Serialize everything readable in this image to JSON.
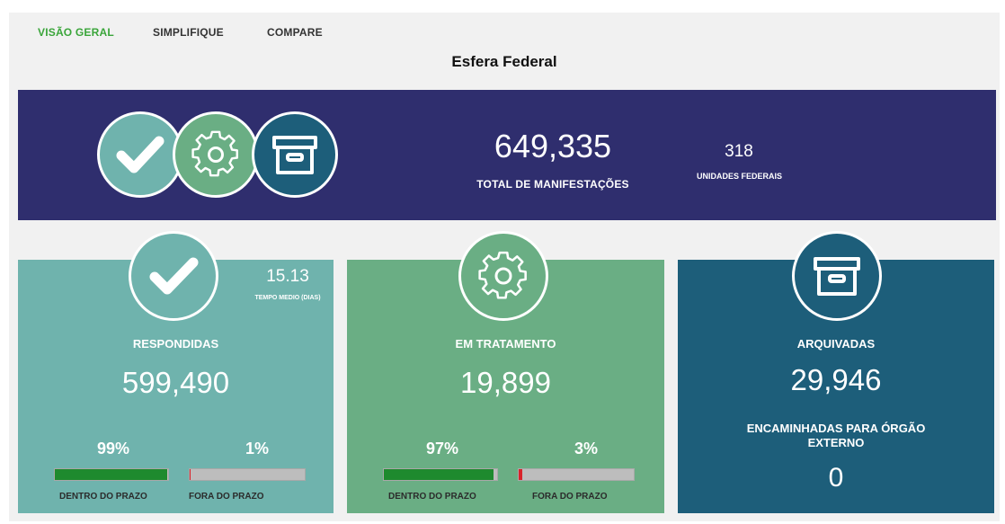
{
  "nav": {
    "tabs": [
      {
        "label": "VISÃO GERAL",
        "active": true
      },
      {
        "label": "SIMPLIFIQUE",
        "active": false
      },
      {
        "label": "COMPARE",
        "active": false
      }
    ]
  },
  "page_title": "Esfera Federal",
  "banner": {
    "total_value": "649,335",
    "total_label": "TOTAL DE MANIFESTAÇÕES",
    "units_value": "318",
    "units_label": "UNIDADES FEDERAIS",
    "icons": [
      "check-icon",
      "gear-icon",
      "archive-box-icon"
    ]
  },
  "cards": {
    "respondidas": {
      "title": "RESPONDIDAS",
      "value": "599,490",
      "time_value": "15.13",
      "time_label": "TEMPO MEDIO (DIAS)",
      "in_pct_label": "99%",
      "out_pct_label": "1%",
      "in_fraction": 0.99,
      "out_fraction": 0.01,
      "in_label": "DENTRO DO PRAZO",
      "out_label": "FORA DO PRAZO",
      "icon": "check-icon"
    },
    "em_tratamento": {
      "title": "EM TRATAMENTO",
      "value": "19,899",
      "in_pct_label": "97%",
      "out_pct_label": "3%",
      "in_fraction": 0.97,
      "out_fraction": 0.03,
      "in_label": "DENTRO DO PRAZO",
      "out_label": "FORA DO PRAZO",
      "icon": "gear-icon"
    },
    "arquivadas": {
      "title": "ARQUIVADAS",
      "value": "29,946",
      "forwarded_label": "ENCAMINHADAS PARA ÓRGÃO EXTERNO",
      "forwarded_value": "0",
      "icon": "archive-box-icon"
    }
  },
  "colors": {
    "nav_active": "#3aa53a",
    "banner_bg": "#2f2e6e",
    "respondidas_bg": "#6fb3ad",
    "tratamento_bg": "#6aae84",
    "arquivadas_bg": "#1d5e7a",
    "on_time": "#1e8a2e",
    "late": "#d8232a"
  }
}
